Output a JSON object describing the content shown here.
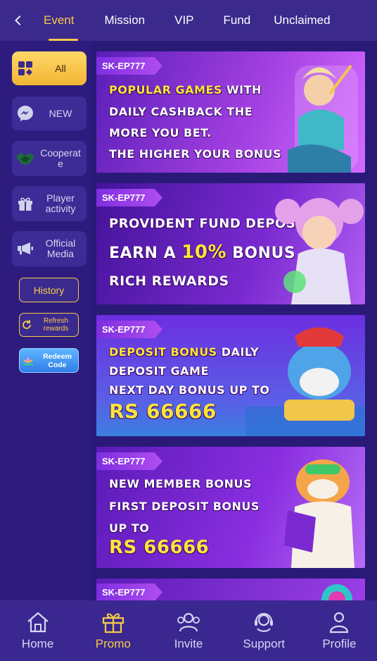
{
  "topnav": {
    "back_icon": "chevron-left-icon",
    "tabs": [
      {
        "label": "Event",
        "active": true
      },
      {
        "label": "Mission",
        "active": false
      },
      {
        "label": "VIP",
        "active": false
      },
      {
        "label": "Fund",
        "active": false
      },
      {
        "label": "Unclaimed",
        "active": false
      }
    ]
  },
  "sidebar": {
    "items": [
      {
        "label": "All",
        "icon": "grid-icon",
        "active": true
      },
      {
        "label": "NEW",
        "icon": "messenger-icon",
        "active": false
      },
      {
        "label": "Cooperate",
        "icon": "handshake-icon",
        "active": false
      },
      {
        "label": "Player activity",
        "icon": "gift-icon",
        "active": false
      },
      {
        "label": "Official Media",
        "icon": "megaphone-icon",
        "active": false
      }
    ],
    "history_label": "History",
    "refresh_label": "Refresh rewards",
    "redeem_label": "Redeem Code"
  },
  "banners": [
    {
      "tag": "SK-EP777",
      "lines": [
        {
          "yellow": "POPULAR GAMES",
          "white": " WITH"
        },
        {
          "yellow": "",
          "white": "DAILY CASHBACK THE"
        },
        {
          "yellow": "",
          "white": "MORE YOU BET."
        },
        {
          "yellow": "",
          "white": "THE HIGHER YOUR BONUS"
        }
      ]
    },
    {
      "tag": "SK-EP777",
      "lines": [
        {
          "yellow": "",
          "white": "PROVIDENT FUND DEPOSIT"
        },
        {
          "white_pre": "EARN A ",
          "yellow": "10%",
          "white": " BONUS"
        },
        {
          "yellow": "",
          "white": "RICH REWARDS"
        }
      ]
    },
    {
      "tag": "SK-EP777",
      "lines": [
        {
          "yellow": "DEPOSIT BONUS",
          "white": " DAILY"
        },
        {
          "yellow": "",
          "white": "DEPOSIT GAME"
        },
        {
          "yellow": "",
          "white": "NEXT DAY BONUS UP TO"
        },
        {
          "yellow": "RS 66666",
          "white": ""
        }
      ]
    },
    {
      "tag": "SK-EP777",
      "lines": [
        {
          "yellow": "",
          "white": "NEW MEMBER BONUS"
        },
        {
          "yellow": "",
          "white": "FIRST DEPOSIT BONUS"
        },
        {
          "yellow": "",
          "white": "UP TO"
        },
        {
          "yellow": "RS 66666",
          "white": ""
        }
      ]
    },
    {
      "tag": "SK-EP777"
    }
  ],
  "bottomnav": [
    {
      "label": "Home",
      "icon": "home-icon",
      "active": false
    },
    {
      "label": "Promo",
      "icon": "gift-icon",
      "active": true
    },
    {
      "label": "Invite",
      "icon": "people-icon",
      "active": false
    },
    {
      "label": "Support",
      "icon": "headset-icon",
      "active": false
    },
    {
      "label": "Profile",
      "icon": "user-icon",
      "active": false
    }
  ],
  "colors": {
    "accent": "#f6c94a",
    "background": "#2a1a78",
    "nav_bg": "#3b2a8c"
  }
}
